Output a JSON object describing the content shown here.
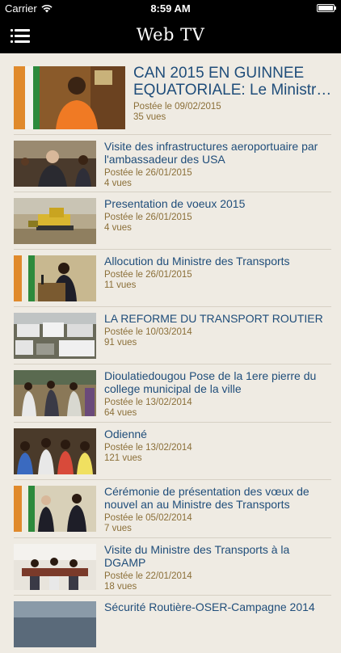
{
  "status": {
    "carrier": "Carrier",
    "time": "8:59 AM"
  },
  "nav": {
    "title": "Web TV",
    "menu_icon": "menu-icon"
  },
  "videos": [
    {
      "title_lines": [
        "CAN 2015 EN GUINNEE",
        "EQUATORIALE: Le Ministr…"
      ],
      "date": "Postée le 09/02/2015",
      "views": "35 vues"
    },
    {
      "title_lines": [
        "Visite des infrastructures aeroportuaire par",
        "l'ambassadeur des USA"
      ],
      "date": "Postée le 26/01/2015",
      "views": "4 vues"
    },
    {
      "title_lines": [
        "Presentation de voeux 2015"
      ],
      "date": "Postée le 26/01/2015",
      "views": "4 vues"
    },
    {
      "title_lines": [
        "Allocution du Ministre des Transports"
      ],
      "date": "Postée le 26/01/2015",
      "views": "11 vues"
    },
    {
      "title_lines": [
        "LA REFORME DU TRANSPORT ROUTIER"
      ],
      "date": "Postée le 10/03/2014",
      "views": "91 vues"
    },
    {
      "title_lines": [
        "Dioulatiedougou Pose de la 1ere pierre du",
        "college municipal de la ville"
      ],
      "date": "Postée le 13/02/2014",
      "views": "64 vues"
    },
    {
      "title_lines": [
        "Odienné"
      ],
      "date": "Postée le 13/02/2014",
      "views": "121 vues"
    },
    {
      "title_lines": [
        "Cérémonie de présentation des vœux de",
        "nouvel an au Ministre des Transports"
      ],
      "date": "Postée le 05/02/2014",
      "views": "7 vues"
    },
    {
      "title_lines": [
        "Visite du Ministre des Transports à la",
        "DGAMP"
      ],
      "date": "Postée le 22/01/2014",
      "views": "18 vues"
    },
    {
      "title_lines": [
        "Sécurité Routière-OSER-Campagne 2014"
      ],
      "date": "",
      "views": ""
    }
  ]
}
